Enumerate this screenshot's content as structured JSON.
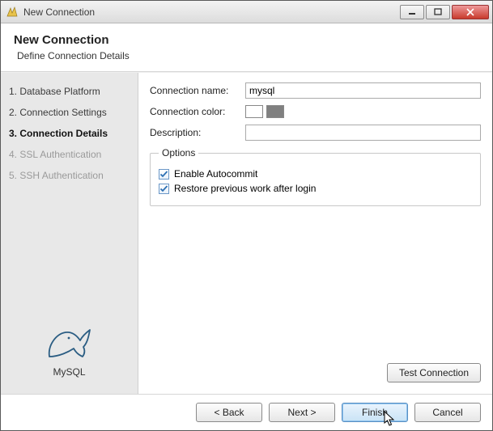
{
  "window": {
    "title": "New Connection"
  },
  "header": {
    "title": "New Connection",
    "subtitle": "Define Connection Details"
  },
  "sidebar": {
    "steps": [
      {
        "label": "1. Database Platform"
      },
      {
        "label": "2. Connection Settings"
      },
      {
        "label": "3. Connection Details"
      },
      {
        "label": "4. SSL Authentication"
      },
      {
        "label": "5. SSH Authentication"
      }
    ],
    "db_label": "MySQL"
  },
  "form": {
    "conn_name_label": "Connection name:",
    "conn_name_value": "mysql",
    "conn_color_label": "Connection color:",
    "description_label": "Description:",
    "description_value": ""
  },
  "options": {
    "legend": "Options",
    "autocommit_label": "Enable Autocommit",
    "restore_label": "Restore previous work after login"
  },
  "buttons": {
    "test": "Test Connection",
    "back": "< Back",
    "next": "Next >",
    "finish": "Finish",
    "cancel": "Cancel"
  }
}
